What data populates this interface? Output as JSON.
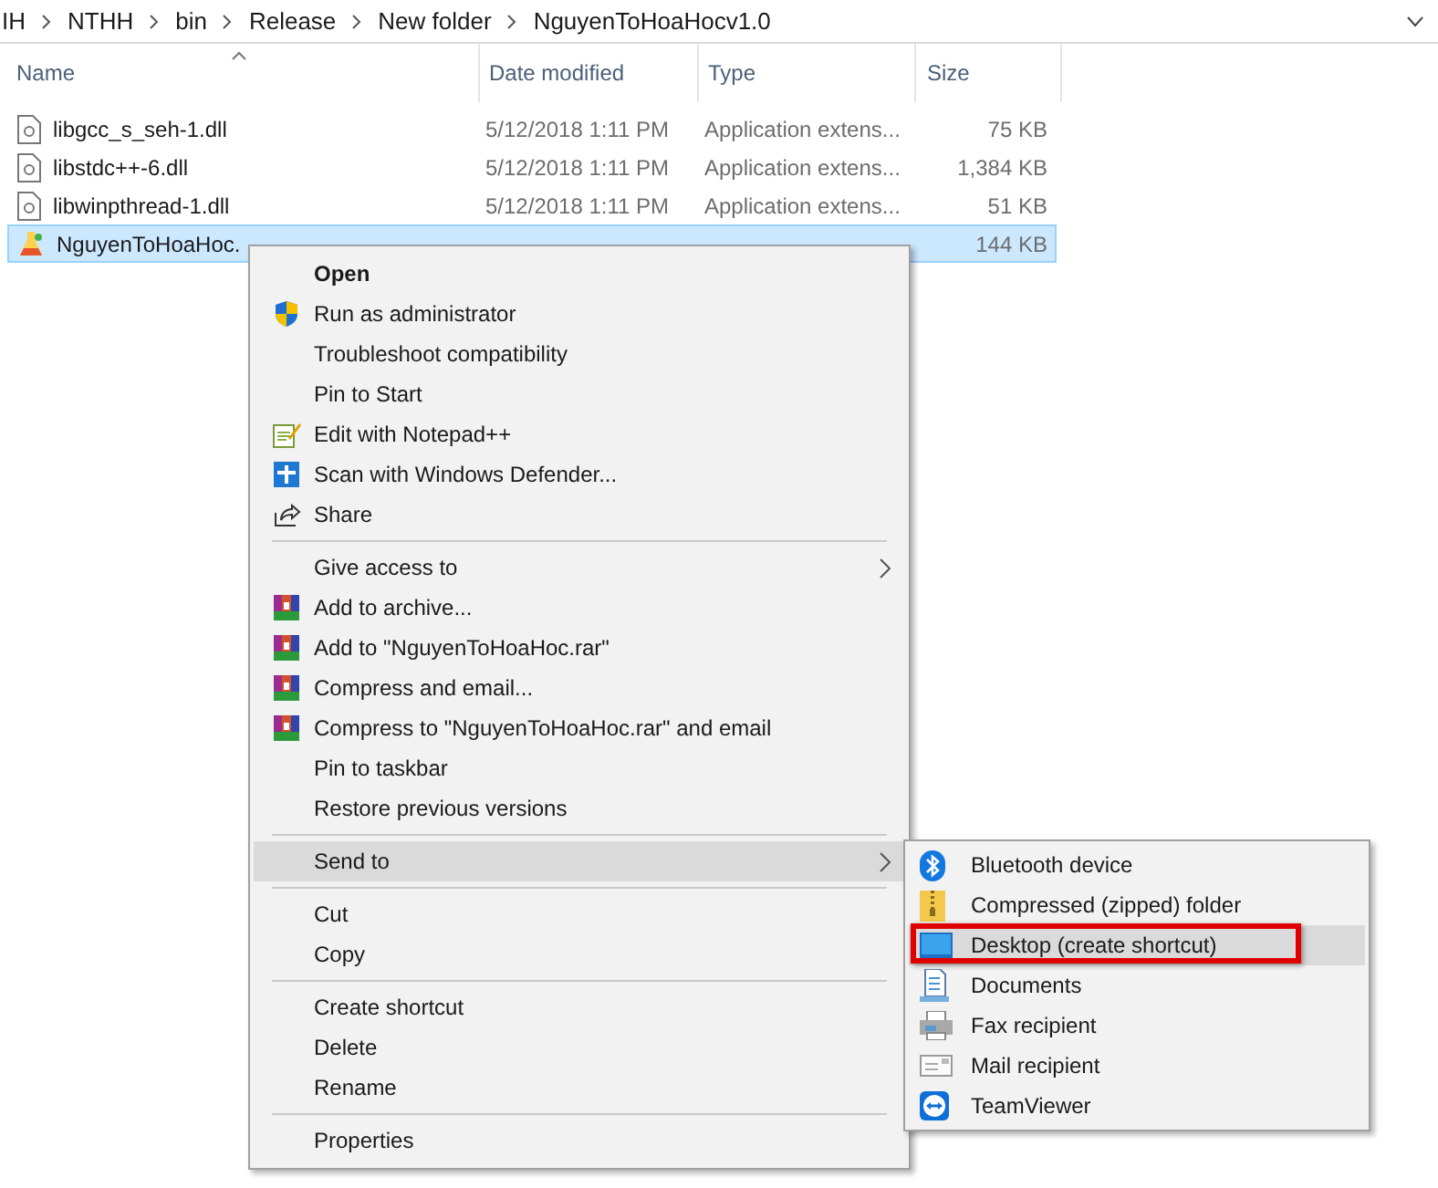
{
  "breadcrumb": [
    "IH",
    "NTHH",
    "bin",
    "Release",
    "New folder",
    "NguyenToHoaHocv1.0"
  ],
  "columns": [
    "Name",
    "Date modified",
    "Type",
    "Size"
  ],
  "files": [
    {
      "name": "libgcc_s_seh-1.dll",
      "date": "5/12/2018 1:11 PM",
      "type": "Application extens...",
      "size": "75 KB",
      "selected": false
    },
    {
      "name": "libstdc++-6.dll",
      "date": "5/12/2018 1:11 PM",
      "type": "Application extens...",
      "size": "1,384 KB",
      "selected": false
    },
    {
      "name": "libwinpthread-1.dll",
      "date": "5/12/2018 1:11 PM",
      "type": "Application extens...",
      "size": "51 KB",
      "selected": false
    },
    {
      "name": "NguyenToHoaHoc.",
      "size": "144 KB",
      "selected": true
    }
  ],
  "context_menu": {
    "groups": [
      [
        {
          "label": "Open",
          "kind": "plain",
          "default": true,
          "selected": false
        },
        {
          "label": "Run as administrator",
          "kind": "shield",
          "default": false,
          "selected": false
        },
        {
          "label": "Troubleshoot compatibility",
          "kind": "plain",
          "default": false,
          "selected": false
        },
        {
          "label": "Pin to Start",
          "kind": "plain",
          "default": false,
          "selected": false
        },
        {
          "label": "Edit with Notepad++",
          "kind": "notepad",
          "default": false,
          "selected": false
        },
        {
          "label": "Scan with Windows Defender...",
          "kind": "defender",
          "default": false,
          "selected": false
        },
        {
          "label": "Share",
          "kind": "share",
          "default": false,
          "selected": false
        }
      ],
      [
        {
          "label": "Give access to",
          "kind": "submenu",
          "default": false,
          "selected": false
        },
        {
          "label": "Add to archive...",
          "kind": "archive",
          "default": false,
          "selected": false
        },
        {
          "label": "Add to \"NguyenToHoaHoc.rar\"",
          "kind": "archive",
          "default": false,
          "selected": false
        },
        {
          "label": "Compress and email...",
          "kind": "archive",
          "default": false,
          "selected": false
        },
        {
          "label": "Compress to \"NguyenToHoaHoc.rar\" and email",
          "kind": "archive",
          "default": false,
          "selected": false
        },
        {
          "label": "Pin to taskbar",
          "kind": "plain",
          "default": false,
          "selected": false
        },
        {
          "label": "Restore previous versions",
          "kind": "plain",
          "default": false,
          "selected": false
        }
      ],
      [
        {
          "label": "Send to",
          "kind": "submenu",
          "default": false,
          "selected": true
        }
      ],
      [
        {
          "label": "Cut",
          "kind": "plain",
          "default": false,
          "selected": false
        },
        {
          "label": "Copy",
          "kind": "plain",
          "default": false,
          "selected": false
        }
      ],
      [
        {
          "label": "Create shortcut",
          "kind": "plain",
          "default": false,
          "selected": false
        },
        {
          "label": "Delete",
          "kind": "plain",
          "default": false,
          "selected": false
        },
        {
          "label": "Rename",
          "kind": "plain",
          "default": false,
          "selected": false
        }
      ],
      [
        {
          "label": "Properties",
          "kind": "plain",
          "default": false,
          "selected": false
        }
      ]
    ]
  },
  "send_to_menu": [
    {
      "label": "Bluetooth device",
      "kind": "bluetooth",
      "selected": false,
      "highlighted": false
    },
    {
      "label": "Compressed (zipped) folder",
      "kind": "zip",
      "selected": false,
      "highlighted": false
    },
    {
      "label": "Desktop (create shortcut)",
      "kind": "desktop",
      "selected": true,
      "highlighted": true
    },
    {
      "label": "Documents",
      "kind": "documents",
      "selected": false,
      "highlighted": false
    },
    {
      "label": "Fax recipient",
      "kind": "fax",
      "selected": false,
      "highlighted": false
    },
    {
      "label": "Mail recipient",
      "kind": "mail",
      "selected": false,
      "highlighted": false
    },
    {
      "label": "TeamViewer",
      "kind": "teamviewer",
      "selected": false,
      "highlighted": false
    }
  ]
}
